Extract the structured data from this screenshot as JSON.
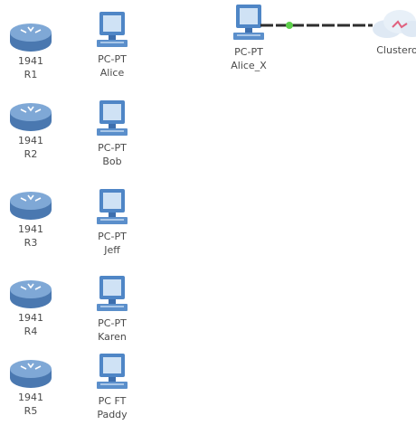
{
  "routers": [
    {
      "model": "1941",
      "name": "R1"
    },
    {
      "model": "1941",
      "name": "R2"
    },
    {
      "model": "1941",
      "name": "R3"
    },
    {
      "model": "1941",
      "name": "R4"
    },
    {
      "model": "1941",
      "name": "R5"
    }
  ],
  "pcs": [
    {
      "model": "PC-PT",
      "name": "Alice"
    },
    {
      "model": "PC-PT",
      "name": "Bob"
    },
    {
      "model": "PC-PT",
      "name": "Jeff"
    },
    {
      "model": "PC-PT",
      "name": "Karen"
    },
    {
      "model": "PC FT",
      "name": "Paddy"
    }
  ],
  "alice_x": {
    "model": "PC-PT",
    "name": "Alice_X"
  },
  "cloud": {
    "name": "Clustero"
  },
  "icons": {
    "router": "router-icon",
    "pc": "pc-icon",
    "cloud": "cloud-icon"
  },
  "colors": {
    "router_body": "#5a88c0",
    "pc_body": "#4f86c6",
    "link_light": "#5ccf4a",
    "link_cable": "#2e2e2e"
  }
}
